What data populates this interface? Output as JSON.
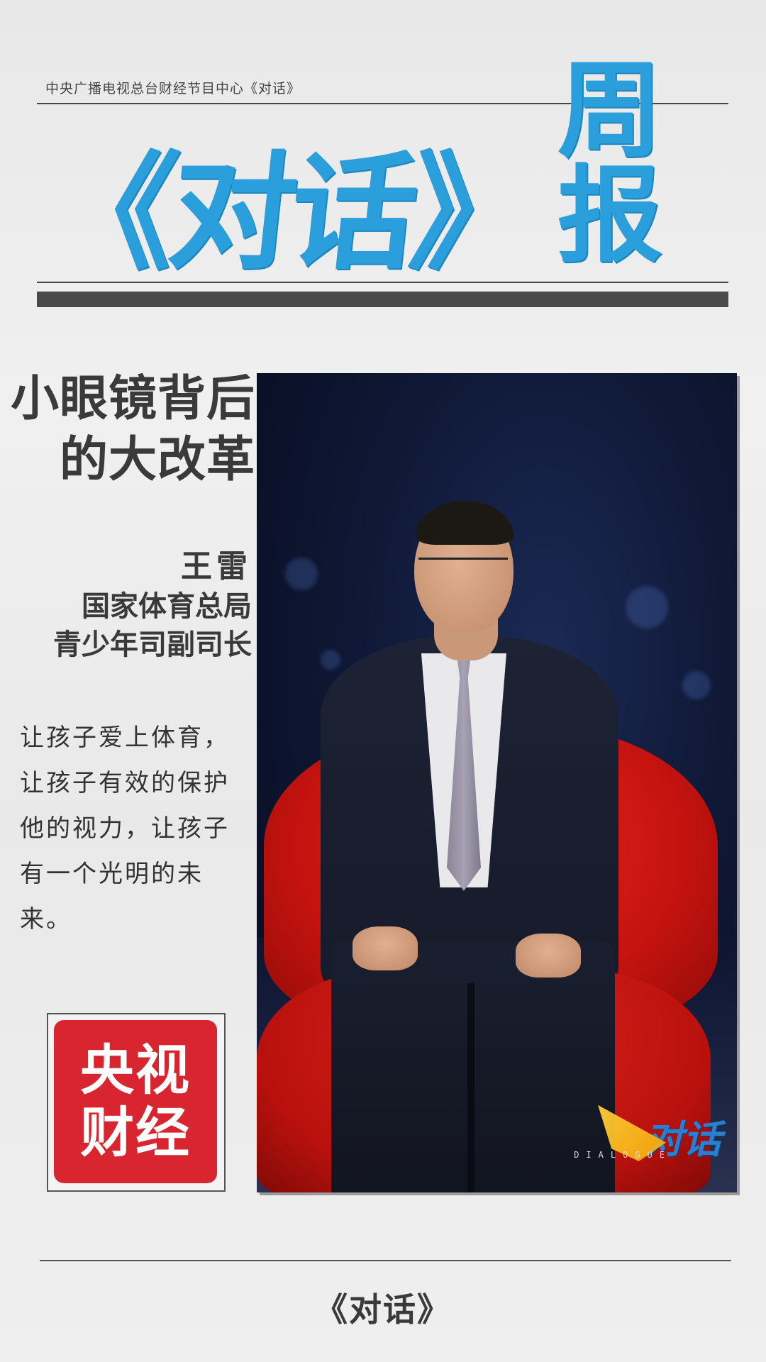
{
  "header": {
    "caption": "中央广播电视总台财经节目中心《对话》",
    "masthead_main": "《对话》",
    "masthead_sub": "周报"
  },
  "article": {
    "headline_lines": [
      "小眼镜背后",
      "的大改革"
    ],
    "guest_name": "王雷",
    "guest_title_lines": [
      "国家体育总局",
      "青少年司副司长"
    ],
    "quote": "让孩子爱上体育，让孩子有效的保护他的视力，让孩子有一个光明的未来。"
  },
  "logo": {
    "lines": [
      "央视",
      "财经"
    ],
    "color": "#d8252f"
  },
  "photo": {
    "watermark_text": "对话",
    "watermark_sub": "DIALOGUE"
  },
  "footer": {
    "title": "《对话》"
  },
  "colors": {
    "accent_blue": "#2a9fdc",
    "text_dark": "#3a3a3a",
    "chair_red": "#c5130f"
  }
}
